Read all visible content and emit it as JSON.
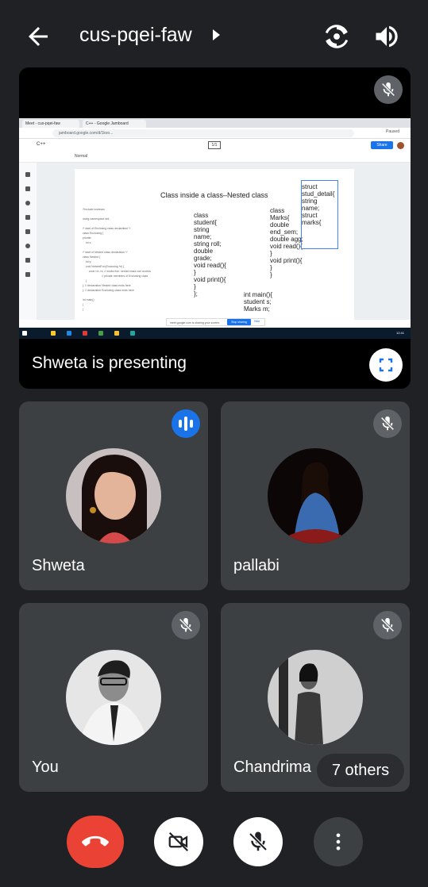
{
  "header": {
    "meeting_code": "cus-pqei-faw",
    "back_icon": "arrow-left-icon",
    "switch_camera_icon": "switch-camera-icon",
    "audio_icon": "speaker-icon"
  },
  "presentation": {
    "presenter_label": "Shweta is presenting",
    "shared_screen": {
      "tab1": "Meet - cus-pqei-faw",
      "tab2": "C++ - Google Jamboard",
      "url": "jamboard.google.com/d/1kvo...",
      "profile_label": "Paused",
      "app_title": "C++",
      "page_indicator": "1/1",
      "share_label": "Share",
      "toolbar_label": "Normal",
      "slide_title": "Class inside a class–Nested class",
      "notes": "/*include iostream\n\nusing namespace std;\n\n/* start of Enclosing class declaration */\nclass Enclosing {\nprivate:\n    int x;\n\n/* start of Nested class declaration */\nclass Nested {\n    int y;\n    void NestedFun(Enclosing *e) {\n        cout<<e->x; // works fine: nested class can access\n                         // private members of Enclosing class\n    }\n}; // declaration Nested class ends here\n}; // declaration Enclosing class ends here\n\nint main()\n{\n}",
      "code_student": "class\nstudent{\nstring\nname;\nstring roll;\ndouble\ngrade;\nvoid read(){\n}\nvoid print(){\n}\n};",
      "code_marks": "class\nMarks{\ndouble\nend_sem;\ndouble agg;\nvoid read(){\n}\nvoid print(){\n}\n}",
      "code_struct": "struct\nstud_detail{\nstring\nname;\nstruct\nmarks{",
      "code_main": "int main(){\nstudent s;\nMarks m;",
      "share_notice": "meet.google.com is sharing your screen.",
      "stop_sharing": "Stop sharing",
      "hide_label": "Hide",
      "clock": "12:41"
    },
    "fullscreen_icon": "fullscreen-icon"
  },
  "participants": [
    {
      "name": "Shweta",
      "status": "speaking",
      "icon": "audio-level-icon"
    },
    {
      "name": "pallabi",
      "status": "muted",
      "icon": "mic-off-icon"
    },
    {
      "name": "You",
      "status": "muted",
      "icon": "mic-off-icon"
    },
    {
      "name": "Chandrima",
      "status": "muted",
      "icon": "mic-off-icon"
    }
  ],
  "others_label": "7 others",
  "controls": {
    "end_call_icon": "phone-hangup-icon",
    "camera_icon": "camera-off-icon",
    "mic_icon": "mic-off-icon",
    "more_icon": "more-vertical-icon"
  },
  "colors": {
    "background": "#202124",
    "tile": "#3c4043",
    "accent_blue": "#1a73e8",
    "end_call_red": "#ea4335",
    "muted_badge": "#5f6368"
  }
}
